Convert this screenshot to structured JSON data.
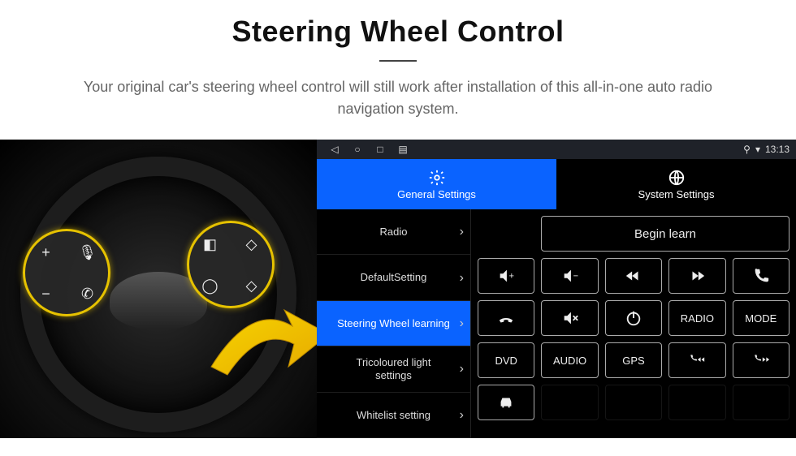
{
  "hero": {
    "title": "Steering Wheel Control",
    "subtitle": "Your original car's steering wheel control will still work after installation of this all-in-one auto radio navigation system."
  },
  "statusbar": {
    "time": "13:13"
  },
  "tabs": {
    "general": "General Settings",
    "system": "System Settings"
  },
  "menu": {
    "items": [
      {
        "label": "Radio"
      },
      {
        "label": "DefaultSetting"
      },
      {
        "label": "Steering Wheel learning"
      },
      {
        "label": "Tricoloured light settings"
      },
      {
        "label": "Whitelist setting"
      }
    ]
  },
  "actions": {
    "begin": "Begin learn",
    "radio": "RADIO",
    "mode": "MODE",
    "dvd": "DVD",
    "audio": "AUDIO",
    "gps": "GPS"
  }
}
